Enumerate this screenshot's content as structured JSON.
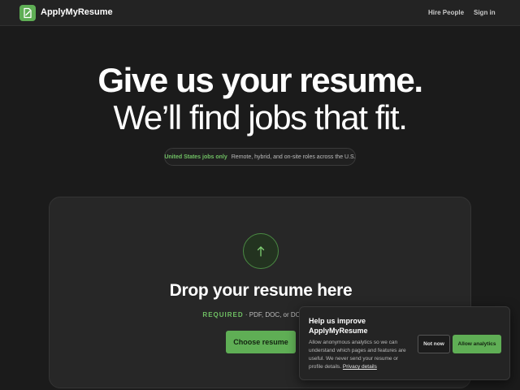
{
  "header": {
    "brand": "ApplyMyResume",
    "logo_icon": "document-icon",
    "nav": {
      "hire_people": "Hire People",
      "sign_in": "Sign in"
    }
  },
  "hero": {
    "headline": "Give us your resume.",
    "subheadline": "We’ll find jobs that fit.",
    "badge": {
      "strong": "United States jobs only",
      "text": "Remote, hybrid, and on-site roles across the U.S."
    }
  },
  "upload": {
    "icon": "upload-arrow-icon",
    "title": "Drop your resume here",
    "required_tag": "REQUIRED",
    "formats": " · PDF, DOC, or DOCX · 1",
    "button_label": "Choose resume"
  },
  "consent": {
    "title": "Help us improve ApplyMyResume",
    "body": "Allow anonymous analytics so we can understand which pages and features are useful. We never send your resume or profile details.",
    "link": "Privacy details",
    "decline_label": "Not now",
    "accept_label": "Allow analytics"
  },
  "colors": {
    "background": "#1b1b1b",
    "accent": "#5fae55",
    "accent_text": "#6fbf63",
    "card": "#272727"
  }
}
